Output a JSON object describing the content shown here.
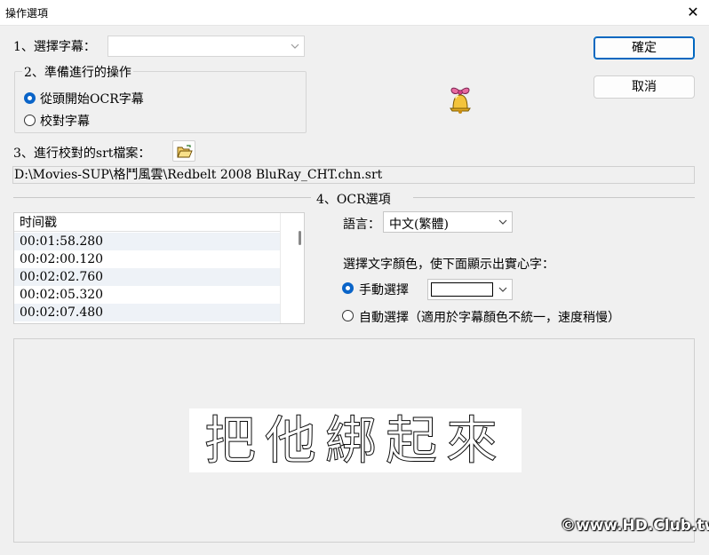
{
  "window": {
    "title": "操作選項",
    "close_glyph": "✕"
  },
  "step1": {
    "label": "1、選擇字幕：",
    "value": ""
  },
  "step2": {
    "legend": "2、準備進行的操作",
    "options": [
      {
        "label": "從頭開始OCR字幕",
        "selected": true
      },
      {
        "label": "校對字幕",
        "selected": false
      }
    ]
  },
  "step3": {
    "label": "3、進行校對的srt檔案：",
    "path": "D:\\Movies-SUP\\格鬥風雲\\Redbelt 2008 BluRay_CHT.chn.srt",
    "open_icon": "folder-open-icon"
  },
  "step4": {
    "label": "4、OCR選項",
    "language_label": "語言：",
    "language_value": "中文(繁體)",
    "color_prompt": "選擇文字顏色，使下面顯示出實心字：",
    "manual_label": "手動選擇",
    "manual_selected": true,
    "auto_label": "自動選擇（適用於字幕顏色不統一，速度稍慢）",
    "auto_selected": false,
    "swatch_color": "#ffffff"
  },
  "timestamps": {
    "header": "时间戳",
    "items": [
      "00:01:58.280",
      "00:02:00.120",
      "00:02:02.760",
      "00:02:05.320",
      "00:02:07.480"
    ]
  },
  "buttons": {
    "ok": "確定",
    "cancel": "取消"
  },
  "mascot_icon": "bell-icon",
  "preview": {
    "subtitle_glyphs": "把他綁起來"
  },
  "watermark": "©www.HD.Club.tw",
  "colors": {
    "accent": "#0067c0",
    "radio": "#0a64c8",
    "background": "#f0f0f0"
  }
}
